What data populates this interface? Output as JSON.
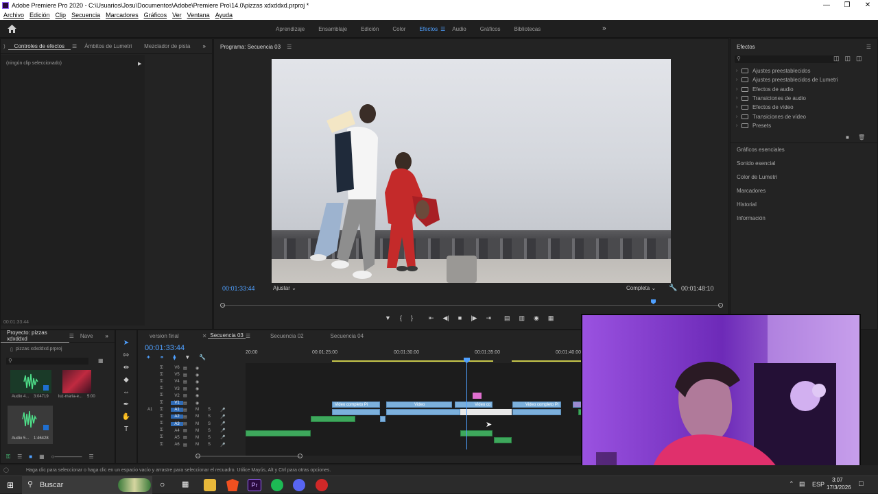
{
  "window": {
    "title": "Adobe Premiere Pro 2020 - C:\\Usuarios\\Josu\\Documentos\\Adobe\\Premiere Pro\\14.0\\pizzas xdxddxd.prproj *"
  },
  "menu": [
    "Archivo",
    "Edición",
    "Clip",
    "Secuencia",
    "Marcadores",
    "Gráficos",
    "Ver",
    "Ventana",
    "Ayuda"
  ],
  "workspaces": {
    "items": [
      "Aprendizaje",
      "Ensamblaje",
      "Edición",
      "Color",
      "Efectos",
      "Audio",
      "Gráficos",
      "Bibliotecas"
    ],
    "active": "Efectos",
    "more": "»"
  },
  "effect_controls": {
    "tabs": [
      "Controles de efectos",
      "Ámbitos de Lumetri",
      "Mezclador de pista"
    ],
    "more": "»",
    "empty_label": "(ningún clip seleccionado)",
    "timecode": "00:01:33:44"
  },
  "program": {
    "title": "Programa: Secuencia 03",
    "timecode": "00:01:33:44",
    "fit": "Ajustar",
    "quality": "Completa",
    "duration": "00:01:48:10"
  },
  "effects_panel": {
    "title": "Efectos",
    "folders": [
      "Ajustes preestablecidos",
      "Ajustes preestablecidos de Lumetri",
      "Efectos de audio",
      "Transiciones de audio",
      "Efectos de vídeo",
      "Transiciones de vídeo",
      "Presets"
    ],
    "sections": [
      "Gráficos esenciales",
      "Sonido esencial",
      "Color de Lumetri",
      "Marcadores",
      "Historial",
      "Información"
    ]
  },
  "project": {
    "tabs": [
      "Proyecto: pizzas xdxddxd",
      "Nave"
    ],
    "more": "»",
    "file": "pizzas xdxddxd.prproj",
    "items": [
      {
        "name": "Audio 4...",
        "duration": "3:04719"
      },
      {
        "name": "luz-maria-e...",
        "duration": "5:00"
      },
      {
        "name": "Audio 5...",
        "duration": "1:46428"
      }
    ]
  },
  "timeline": {
    "tabs": [
      "version final",
      "Secuencia 03",
      "Secuencia 02",
      "Secuencia 04"
    ],
    "active": "Secuencia 03",
    "timecode": "00:01:33:44",
    "ruler": [
      "20:00",
      "00:01:25:00",
      "00:01:30:00",
      "00:01:35:00",
      "00:01:40:00"
    ],
    "video_tracks": [
      "V6",
      "V5",
      "V4",
      "V3",
      "V2",
      "V1"
    ],
    "audio_tracks": [
      "A1",
      "A2",
      "A3",
      "A4",
      "A5",
      "A6"
    ],
    "source_label": "A1",
    "clips": [
      "Video completo Pi",
      "Video",
      "Video co",
      "Video completo Pi"
    ]
  },
  "status": "Haga clic para seleccionar o haga clic en un espacio vacío y arrastre para seleccionar el recuadro. Utilice Mayús, Alt y Ctrl para otras opciones.",
  "taskbar": {
    "search": "Buscar",
    "lang": "ESP",
    "time": "3:07",
    "date": "17/3/2026"
  }
}
